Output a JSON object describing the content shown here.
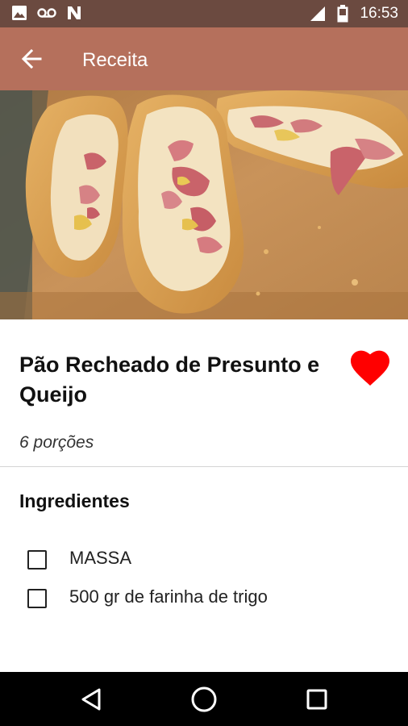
{
  "status_bar": {
    "time": "16:53",
    "left_icons": [
      "image-icon",
      "voicemail-icon",
      "n-notification-icon"
    ],
    "right_icons": [
      "signal-icon",
      "battery-icon"
    ]
  },
  "app_bar": {
    "title": "Receita",
    "back_icon": "arrow-back-icon",
    "color": "#b5705c"
  },
  "recipe": {
    "title": "Pão Recheado de Presunto e Queijo",
    "portions": "6 porções",
    "favorite": true,
    "favorite_color": "#ff0000"
  },
  "ingredients_section": {
    "title": "Ingredientes",
    "items": [
      {
        "label": "MASSA",
        "checked": false
      },
      {
        "label": "500 gr de farinha de trigo",
        "checked": false
      }
    ]
  },
  "nav_bar": {
    "buttons": [
      "back-triangle-icon",
      "home-circle-icon",
      "recents-square-icon"
    ]
  }
}
